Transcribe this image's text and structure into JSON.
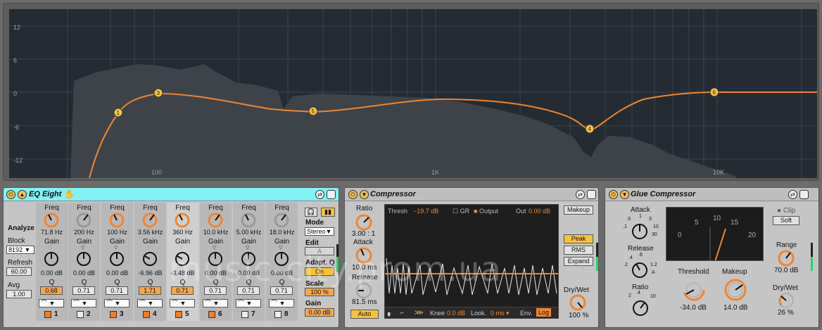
{
  "spectrum": {
    "db_ticks": [
      "12",
      "6",
      "0",
      "-6",
      "-12"
    ],
    "freq_ticks": [
      "100",
      "1K",
      "10K"
    ],
    "bands": [
      "1",
      "3",
      "5",
      "4",
      "6"
    ]
  },
  "colors": {
    "curve": "#f2852d",
    "active_header": "#7ff3f5",
    "orange": "#f9a64b",
    "dot": "#f7c23e"
  },
  "eq": {
    "title": "EQ Eight",
    "analyze": "Analyze",
    "block": "Block",
    "block_val": "8192",
    "refresh": "Refresh",
    "refresh_val": "60.00",
    "avg": "Avg",
    "avg_val": "1.00",
    "freq_label": "Freq",
    "gain_label": "Gain",
    "q_label": "Q",
    "bands": [
      {
        "num": "1",
        "freq": "71.8 Hz",
        "gain": "0.00 dB",
        "q": "0.68",
        "on": true,
        "qor": true
      },
      {
        "num": "2",
        "freq": "200 Hz",
        "gain": "0.00 dB",
        "q": "0.71",
        "on": false,
        "qor": false
      },
      {
        "num": "3",
        "freq": "100 Hz",
        "gain": "0.00 dB",
        "q": "0.71",
        "on": true,
        "qor": false
      },
      {
        "num": "4",
        "freq": "3.56 kHz",
        "gain": "-6.96 dB",
        "q": "1.71",
        "on": true,
        "qor": true
      },
      {
        "num": "5",
        "freq": "360 Hz",
        "gain": "-3.48 dB",
        "q": "0.71",
        "on": true,
        "qor": true
      },
      {
        "num": "6",
        "freq": "10.0 kHz",
        "gain": "0.00 dB",
        "q": "0.71",
        "on": true,
        "qor": false
      },
      {
        "num": "7",
        "freq": "5.00 kHz",
        "gain": "0.00 dB",
        "q": "0.71",
        "on": false,
        "qor": false
      },
      {
        "num": "8",
        "freq": "18.0 kHz",
        "gain": "0.00 dB",
        "q": "0.71",
        "on": false,
        "qor": false
      }
    ],
    "mode": "Mode",
    "mode_val": "Stereo",
    "edit": "Edit",
    "edit_val": "A",
    "adapt": "Adapt. Q",
    "adapt_val": "On",
    "scale": "Scale",
    "scale_val": "100 %",
    "gain": "Gain",
    "gain_val": "0.00 dB"
  },
  "comp": {
    "title": "Compressor",
    "ratio": "Ratio",
    "ratio_val": "3.00 : 1",
    "attack": "Attack",
    "attack_val": "10.0 ms",
    "release": "Release",
    "release_val": "81.5 ms",
    "auto": "Auto",
    "thresh": "Thresh",
    "thresh_val": "−19.7 dB",
    "gr": "GR",
    "output": "Output",
    "out": "Out",
    "out_val": "0.00 dB",
    "knee": "Knee",
    "knee_val": "0.0 dB",
    "look": "Look.",
    "look_val": "0 ms",
    "env": "Env.",
    "env_val": "Log",
    "makeup": "Makeup",
    "peak": "Peak",
    "rms": "RMS",
    "expand": "Expand",
    "drywet": "Dry/Wet",
    "drywet_val": "100 %"
  },
  "glue": {
    "title": "Glue Compressor",
    "attack": "Attack",
    "attack_ticks": [
      ".3",
      "1",
      "3",
      ".1",
      "10",
      "30"
    ],
    "release": "Release",
    "release_ticks": [
      ".4",
      ".6",
      "1.2",
      ".2",
      "A"
    ],
    "ratio": "Ratio",
    "ratio_ticks": [
      "2",
      "4",
      "10"
    ],
    "meter_ticks": [
      "0",
      "5",
      "10",
      "15",
      "20"
    ],
    "threshold": "Threshold",
    "threshold_val": "-34.0 dB",
    "makeup": "Makeup",
    "makeup_val": "14.0 dB",
    "clip": "Clip",
    "soft": "Soft",
    "range": "Range",
    "range_val": "70.0 dB",
    "drywet": "Dry/Wet",
    "drywet_val": "26 %"
  },
  "watermark": "music-city.prom.ua"
}
